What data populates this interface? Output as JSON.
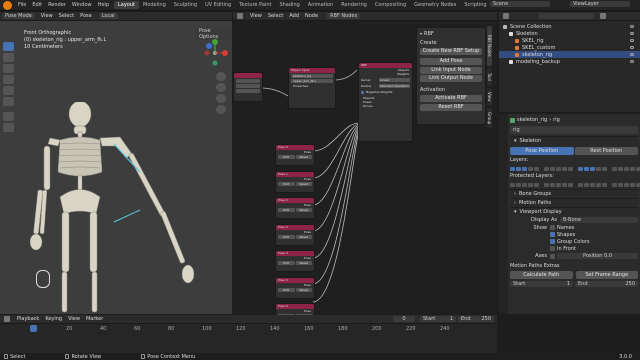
{
  "menu": {
    "items": [
      "File",
      "Edit",
      "Render",
      "Window",
      "Help"
    ],
    "workspaces": [
      "Layout",
      "Modeling",
      "Sculpting",
      "UV Editing",
      "Texture Paint",
      "Shading",
      "Animation",
      "Rendering",
      "Compositing",
      "Geometry Nodes",
      "Scripting"
    ],
    "active_workspace": "Layout",
    "scene_label": "Scene",
    "view_layer_label": "ViewLayer"
  },
  "viewport": {
    "mode": "Pose Mode",
    "menus": [
      "View",
      "Select",
      "Pose"
    ],
    "transform": "Local",
    "pose_options": "Pose Options",
    "overlay_title": "Front Orthographic",
    "overlay_object": "(0) skeleton_rig : upper_arm_fk.L",
    "overlay_scale": "10 Centimeters"
  },
  "node_editor": {
    "menus": [
      "View",
      "Select",
      "Add",
      "Node"
    ],
    "tree_name": "RBF Nodes",
    "object_input_node": {
      "title": "Object Input",
      "field1": "skeleton_rig",
      "field2": "upper_arm_fk.L",
      "socket": "Properties",
      "socket_out": "Object"
    },
    "rbf_node": {
      "title": "RBF",
      "in1": "Objects",
      "in2": "Poses",
      "kernel_label": "Kernel",
      "kernel": "Linear",
      "radius_label": "Radius",
      "radius": "Standard Deviation",
      "negative_weights": "Negative Weights",
      "outputs": [
        "Objects",
        "Poses",
        "Driven"
      ],
      "out_labels": [
        "Objects",
        "Weights"
      ]
    },
    "scalar_node": {
      "title": "Object Input",
      "fields": [
        "Location",
        "Z"
      ]
    },
    "pose_nodes": [
      {
        "title": "Pose 0",
        "socket": "Pose",
        "btn1": "Edit",
        "btn2": "Reset"
      },
      {
        "title": "Pose 1",
        "socket": "Pose",
        "btn1": "Edit",
        "btn2": "Reset"
      },
      {
        "title": "Pose 2",
        "socket": "Pose",
        "btn1": "Edit",
        "btn2": "Reset"
      },
      {
        "title": "Pose 3",
        "socket": "Pose",
        "btn1": "Edit",
        "btn2": "Reset"
      },
      {
        "title": "Pose 4",
        "socket": "Pose",
        "btn1": "Edit",
        "btn2": "Reset"
      },
      {
        "title": "Pose 5",
        "socket": "Pose",
        "btn1": "Edit",
        "btn2": "Reset"
      },
      {
        "title": "Pose 6",
        "socket": "Pose",
        "btn1": "Edit",
        "btn2": "Reset"
      }
    ],
    "side_tabs": [
      "RBF Nodes",
      "Tool",
      "View",
      "Group"
    ]
  },
  "rbf_panel": {
    "title": "RBF",
    "create_label": "Create",
    "create_btn": "Create New RBF Setup",
    "add_pose_btn": "Add Pose",
    "link_input_btn": "Link Input Node",
    "link_output_btn": "Link Output Node",
    "activation_label": "Activation",
    "activate_btn": "Activate RBF",
    "reset_btn": "Reset RBF"
  },
  "outliner": {
    "items": [
      {
        "label": "Scene Collection",
        "indent": 0
      },
      {
        "label": "Skeleton",
        "indent": 1
      },
      {
        "label": "SKEL_rig",
        "indent": 2
      },
      {
        "label": "SKEL_custom",
        "indent": 2
      },
      {
        "label": "skeleton_rig",
        "indent": 2,
        "selected": true
      },
      {
        "label": "modeling_backup",
        "indent": 1
      }
    ]
  },
  "properties": {
    "path": [
      "skeleton_rig",
      "rig"
    ],
    "data_name": "rig",
    "skeleton_section": "Skeleton",
    "pose_position": "Pose Position",
    "rest_position": "Rest Position",
    "layers_label": "Layers:",
    "protected_label": "Protected Layers:",
    "bone_groups": "Bone Groups",
    "motion_paths": "Motion Paths",
    "viewport_display": "Viewport Display",
    "display_as_label": "Display As",
    "display_as": "B-Bone",
    "show_label": "Show",
    "show_items": [
      "Names",
      "Shapes",
      "Group Colors",
      "In Front"
    ],
    "show_checked": [
      false,
      true,
      true,
      false
    ],
    "axes_label": "Axes",
    "axes_value": "Position",
    "axes_num": "0.0",
    "motion_extras": "Motion Paths Extras",
    "calc_path": "Calculate Path",
    "set_frame_range": "Set Frame Range",
    "start_label": "Start",
    "start_value": "1",
    "end_label": "End",
    "end_value": "250"
  },
  "timeline": {
    "menus": [
      "Playback",
      "Keying",
      "View",
      "Marker"
    ],
    "current_frame": "0",
    "start_label": "Start",
    "start": "1",
    "end_label": "End",
    "end": "250",
    "ticks": [
      "0",
      "20",
      "40",
      "60",
      "80",
      "100",
      "120",
      "140",
      "160",
      "180",
      "200",
      "220",
      "240"
    ]
  },
  "status": {
    "items": [
      "Select",
      "Rotate View",
      "Pose Context Menu"
    ],
    "version": "3.0.0"
  },
  "colors": {
    "accent": "#4772b3",
    "node_header": "#8d2347",
    "ws_active": "#3d3d3d"
  }
}
